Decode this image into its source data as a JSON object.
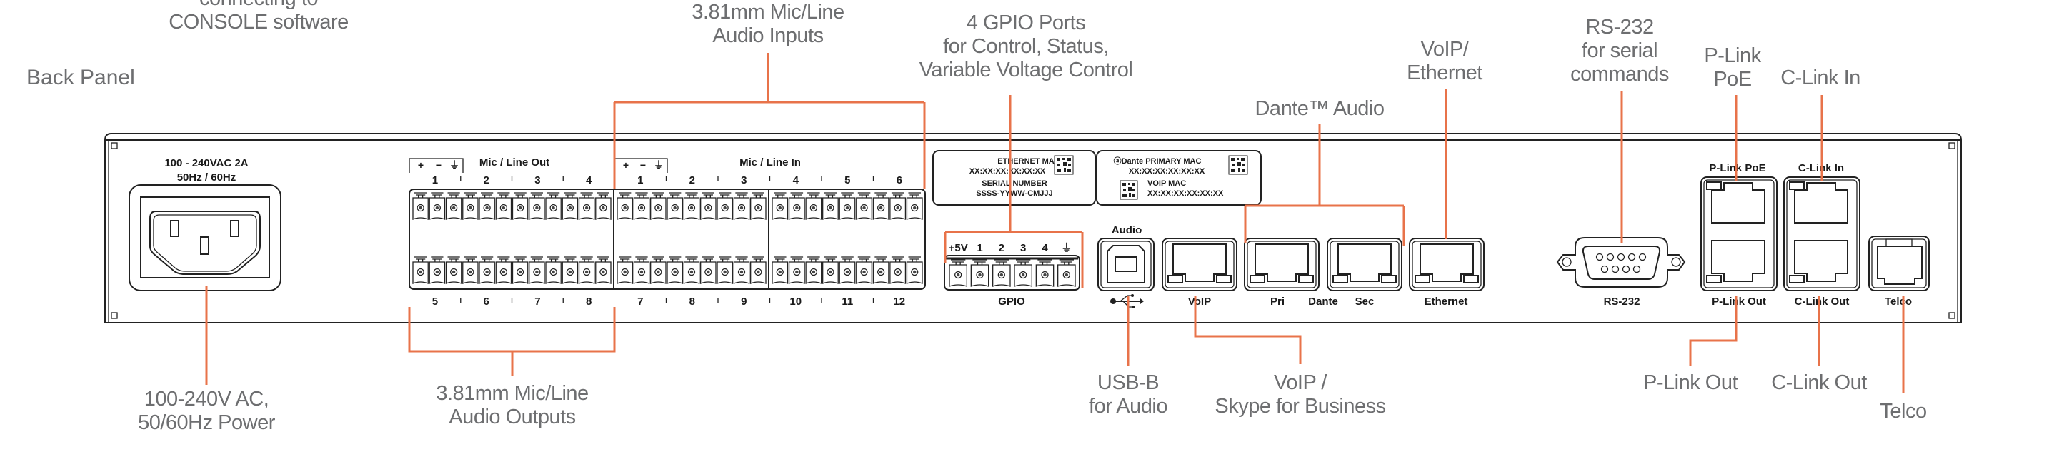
{
  "section_title": "Back Panel",
  "accent_color": "#e8734a",
  "callout_color": "#6d6e70",
  "callouts": {
    "console": [
      "connecting to",
      "CONSOLE software"
    ],
    "audio_inputs": [
      "3.81mm Mic/Line",
      "Audio Inputs"
    ],
    "gpio": [
      "4 GPIO Ports",
      "for Control, Status,",
      "Variable Voltage Control"
    ],
    "dante": [
      "Dante™ Audio"
    ],
    "voip_ethernet": [
      "VoIP/",
      "Ethernet"
    ],
    "rs232": [
      "RS-232",
      "for serial",
      "commands"
    ],
    "plink_poe": [
      "P-Link",
      "PoE"
    ],
    "clink_in": [
      "C-Link In"
    ],
    "power": [
      "100-240V AC,",
      "50/60Hz Power"
    ],
    "audio_outputs": [
      "3.81mm Mic/Line",
      "Audio Outputs"
    ],
    "usb": [
      "USB-B",
      "for Audio"
    ],
    "voip_skype": [
      "VoIP /",
      "Skype for Business"
    ],
    "plink_out": [
      "P-Link Out"
    ],
    "clink_out": [
      "C-Link Out"
    ],
    "telco": [
      "Telco"
    ]
  },
  "panel": {
    "power_rating": [
      "100 - 240VAC  2A",
      "50Hz / 60Hz"
    ],
    "mic_line_out": {
      "title": "Mic / Line Out",
      "polarity": [
        "+",
        "−",
        "⏚"
      ],
      "top_channels": [
        "1",
        "2",
        "3",
        "4"
      ],
      "bottom_channels": [
        "5",
        "6",
        "7",
        "8"
      ]
    },
    "mic_line_in": {
      "title": "Mic / Line In",
      "polarity": [
        "+",
        "−",
        "⏚"
      ],
      "top_channels": [
        "1",
        "2",
        "3",
        "4",
        "5",
        "6"
      ],
      "bottom_channels": [
        "7",
        "8",
        "9",
        "10",
        "11",
        "12"
      ]
    },
    "label_left": {
      "ethernet_mac_title": "ETHERNET MAC",
      "ethernet_mac": "XX:XX:XX:XX:XX:XX",
      "serial_title": "SERIAL NUMBER",
      "serial": "SSSS-YYWW-CMJJJ"
    },
    "label_right": {
      "dante_primary_title": "ⓐDante PRIMARY MAC",
      "dante_primary_mac": "XX:XX:XX:XX:XX:XX",
      "voip_mac_title": "VOIP MAC",
      "voip_mac": "XX:XX:XX:XX:XX:XX"
    },
    "gpio": {
      "pins": [
        "+5V",
        "1",
        "2",
        "3",
        "4",
        "⏚"
      ],
      "label": "GPIO"
    },
    "usb": {
      "top_label": "Audio",
      "icon": "usb-icon"
    },
    "ports": {
      "voip": "VoIP",
      "pri": "Pri",
      "dante_logo": "Dante",
      "sec": "Sec",
      "ethernet": "Ethernet",
      "rs232": "RS-232",
      "plink_poe": "P-Link PoE",
      "plink_out": "P-Link Out",
      "clink_in": "C-Link In",
      "clink_out": "C-Link Out",
      "telco": "Telco"
    }
  }
}
